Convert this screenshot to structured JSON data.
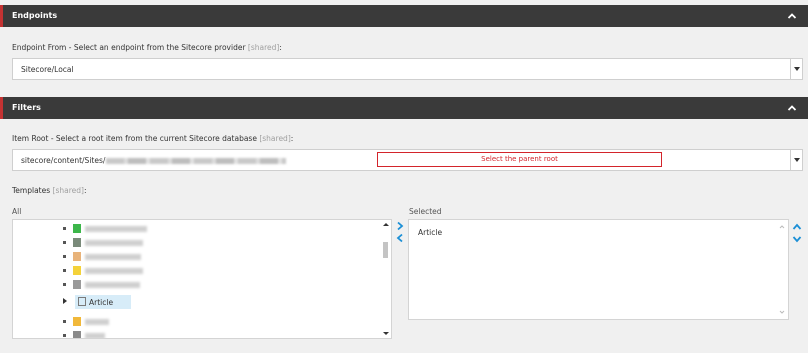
{
  "endpoints": {
    "title": "Endpoints",
    "label": "Endpoint From - Select an endpoint from the Sitecore provider",
    "shared": "[shared]",
    "colon": ":",
    "value": "Sitecore/Local"
  },
  "filters": {
    "title": "Filters",
    "item_root_label": "Item Root - Select a root item from the current Sitecore database",
    "shared": "[shared]",
    "colon": ":",
    "item_root_value": "sitecore/content/Sites/",
    "select_parent_label": "Select the parent root",
    "templates_label": "Templates",
    "all_label": "All",
    "selected_label": "Selected",
    "tree": {
      "selected_item": "Article"
    },
    "selected_items": [
      "Article"
    ]
  },
  "colors": {
    "header_bg": "#3a3a3a",
    "accent_red": "#c43232",
    "link_blue": "#1b8fd6",
    "selection_bg": "#d7ecf8"
  },
  "icons": {
    "collapse": "chevron-up-icon",
    "dropdown": "caret-down-icon",
    "move_right": "chevron-right-icon",
    "move_left": "chevron-left-icon",
    "order_up": "chevron-up-icon",
    "order_down": "chevron-down-icon"
  }
}
